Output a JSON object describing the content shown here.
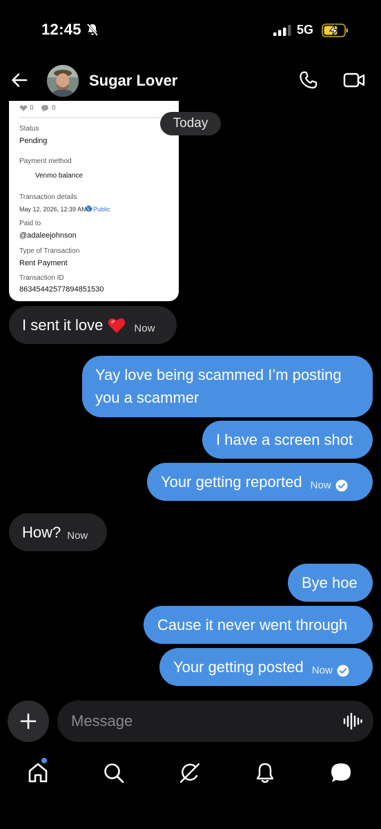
{
  "status_bar": {
    "time": "12:45",
    "network": "5G"
  },
  "header": {
    "contact_name": "Sugar Lover"
  },
  "shared_image": {
    "likes": "0",
    "comments": "0",
    "status_label": "Status",
    "status_value": "Pending",
    "payment_method_label": "Payment method",
    "payment_method_value": "Venmo balance",
    "transaction_details_label": "Transaction details",
    "transaction_date": "May 12, 2026, 12:39 AM ·",
    "visibility": "Public",
    "paid_to_label": "Paid to",
    "paid_to_value": "@adaleejohnson",
    "type_label": "Type of Transaction",
    "type_value": "Rent Payment",
    "transaction_id_label": "Transaction ID",
    "transaction_id_value": "86345442577894851530"
  },
  "date_separator": "Today",
  "messages": [
    {
      "direction": "in",
      "text": "I sent it love",
      "time": "Now"
    },
    {
      "direction": "out",
      "text_line1": "Yay love being scammed I’m posting",
      "text_line2": "you a scammer"
    },
    {
      "direction": "out",
      "text": "I have a screen shot"
    },
    {
      "direction": "out",
      "text": "Your getting reported",
      "time": "Now"
    },
    {
      "direction": "in",
      "text": "How?",
      "time": "Now"
    },
    {
      "direction": "out",
      "text": "Bye hoe"
    },
    {
      "direction": "out",
      "text": "Cause it never went through"
    },
    {
      "direction": "out",
      "text": "Your getting posted",
      "time": "Now"
    }
  ],
  "composer": {
    "placeholder": "Message"
  },
  "colors": {
    "outgoing_bubble": "#4a90e2",
    "incoming_bubble": "#232325",
    "background": "#000000"
  },
  "icons": [
    "bell-off-icon",
    "signal-icon",
    "battery-charging-icon",
    "back-arrow-icon",
    "phone-icon",
    "video-icon",
    "plus-icon",
    "voice-wave-icon",
    "home-icon",
    "search-icon",
    "grok-icon",
    "bell-icon",
    "messages-icon"
  ]
}
